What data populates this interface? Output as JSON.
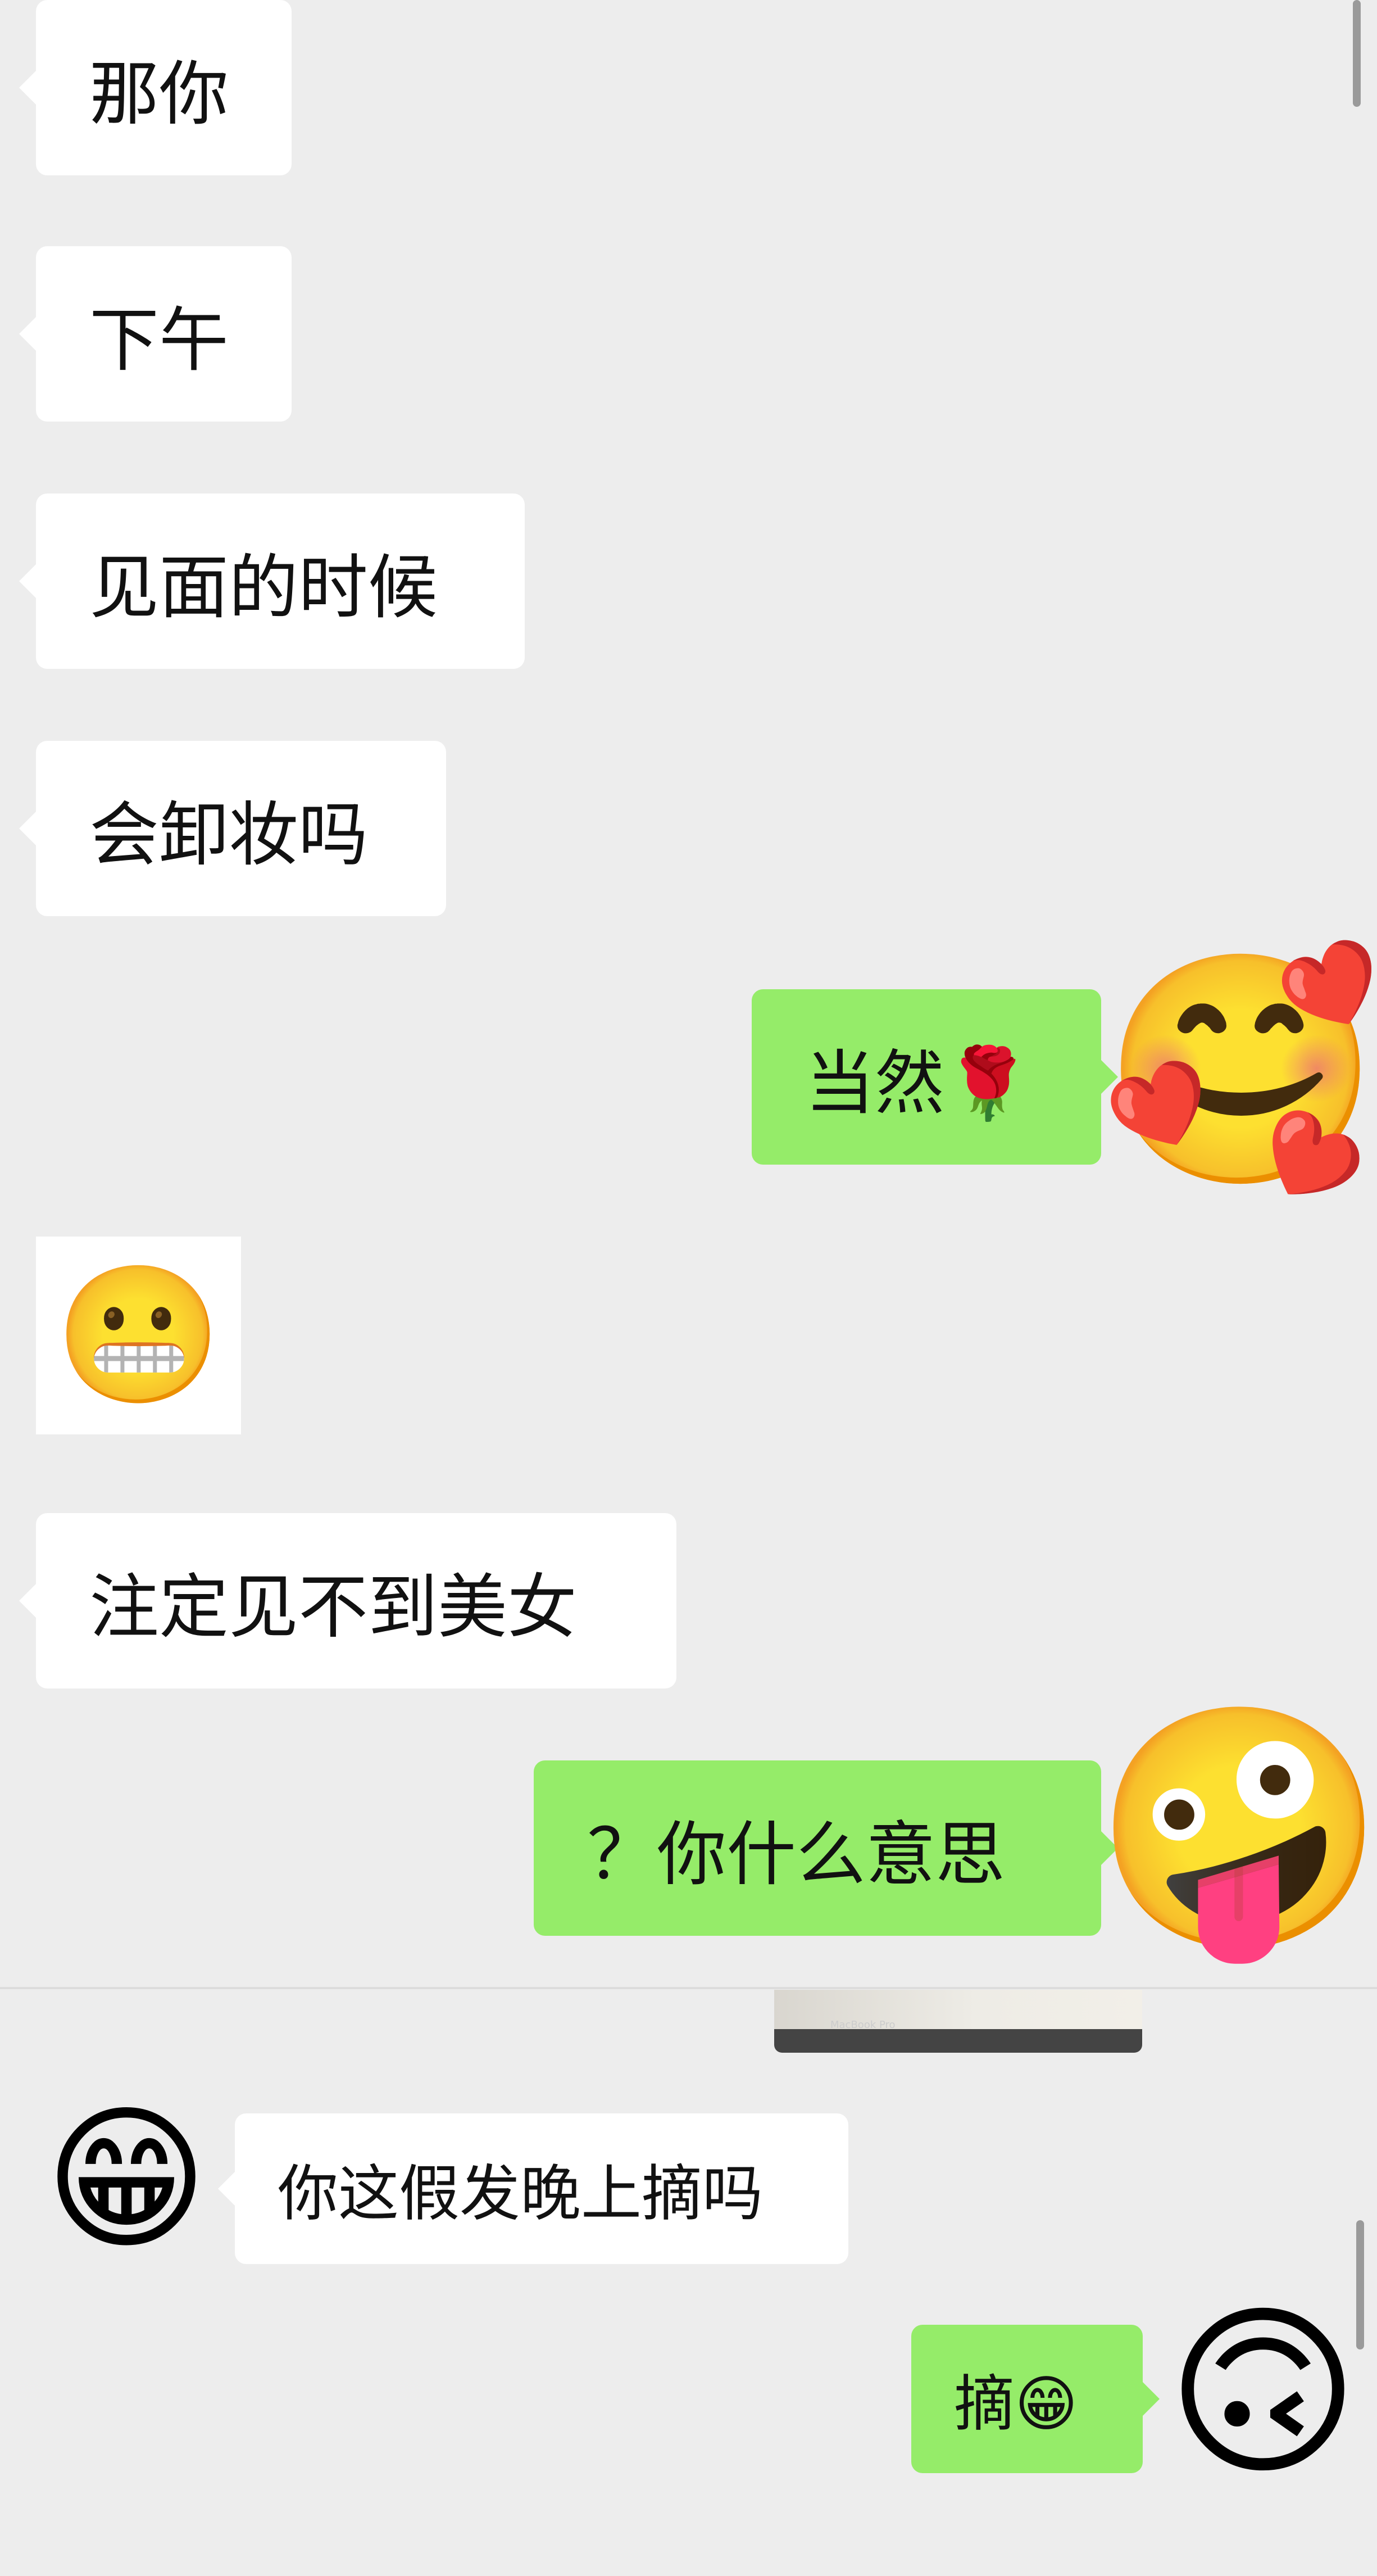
{
  "chat_top": {
    "messages": [
      {
        "side": "left",
        "text": "那你"
      },
      {
        "side": "left",
        "text": "下午"
      },
      {
        "side": "left",
        "text": "见面的时候"
      },
      {
        "side": "left",
        "text": "会卸妆吗"
      },
      {
        "side": "right",
        "text": "当然🌹",
        "avatar_icon": "smiling-face-with-hearts-icon",
        "avatar": "🥰"
      },
      {
        "side": "left",
        "type": "sticker",
        "sticker": "😬",
        "sticker_icon": "grimacing-face-sticker"
      },
      {
        "side": "left",
        "text": "注定见不到美女"
      },
      {
        "side": "right",
        "text": "？你什么意思",
        "avatar_icon": "zany-face-icon",
        "avatar": "🤪"
      }
    ]
  },
  "chat_bottom": {
    "messages": [
      {
        "side": "left",
        "text": "你这假发晚上摘吗",
        "avatar_icon": "grinning-face-icon",
        "avatar": "😁"
      },
      {
        "side": "right",
        "text": "摘😁",
        "avatar_icon": "upside-down-face-icon",
        "avatar": "🙃"
      }
    ],
    "image_caption": "MacBook Pro"
  }
}
